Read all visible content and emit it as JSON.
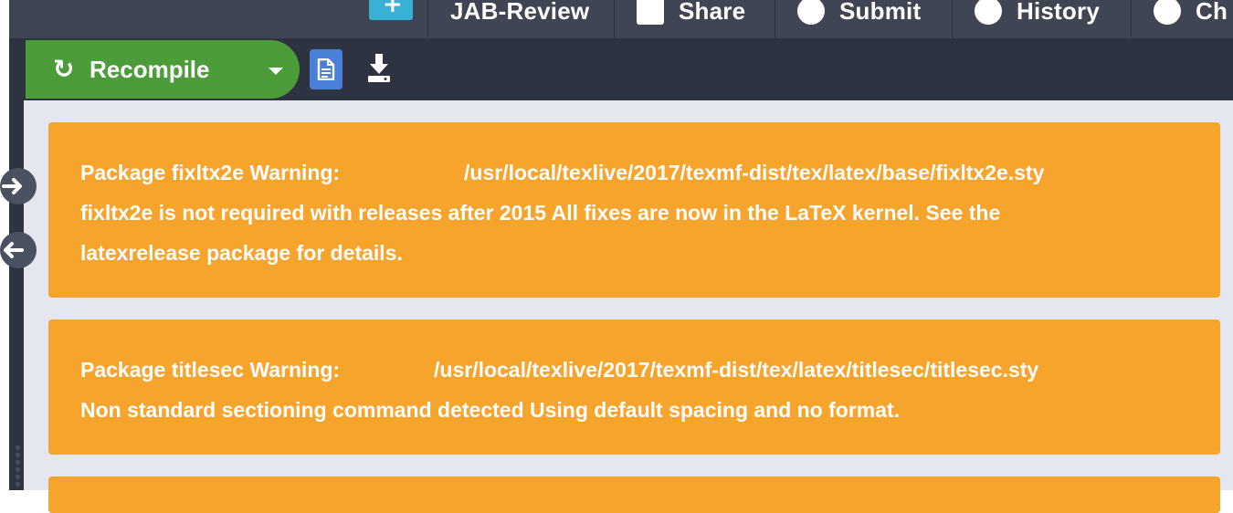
{
  "header": {
    "menu": [
      {
        "label": "JAB-Review",
        "icon": "jab-review-icon"
      },
      {
        "label": "Share",
        "icon": "share-icon"
      },
      {
        "label": "Submit",
        "icon": "submit-icon"
      },
      {
        "label": "History",
        "icon": "history-icon"
      },
      {
        "label": "Ch",
        "icon": "chat-icon"
      }
    ]
  },
  "toolbar": {
    "recompile_label": "Recompile",
    "recompile_icon": "refresh-icon",
    "logs_icon": "document-icon",
    "download_icon": "download-icon"
  },
  "colors": {
    "recompile_green": "#4c9c3a",
    "warning_orange": "#f7a42d",
    "toolbar_dark": "#2d3341",
    "pane_background": "#e4e7ef",
    "logs_blue": "#4a80d9"
  },
  "warnings": [
    {
      "title": "Package fixltx2e Warning:",
      "path": "/usr/local/texlive/2017/texmf-dist/tex/latex/base/fixltx2e.sty",
      "message_line1": "fixltx2e is not required with releases after 2015 All fixes are now in the LaTeX kernel. See the",
      "message_line2": "latexrelease package for details."
    },
    {
      "title": "Package titlesec Warning:",
      "path": "/usr/local/texlive/2017/texmf-dist/tex/latex/titlesec/titlesec.sty",
      "message_line1": "Non standard sectioning command detected Using default spacing and no format."
    }
  ]
}
